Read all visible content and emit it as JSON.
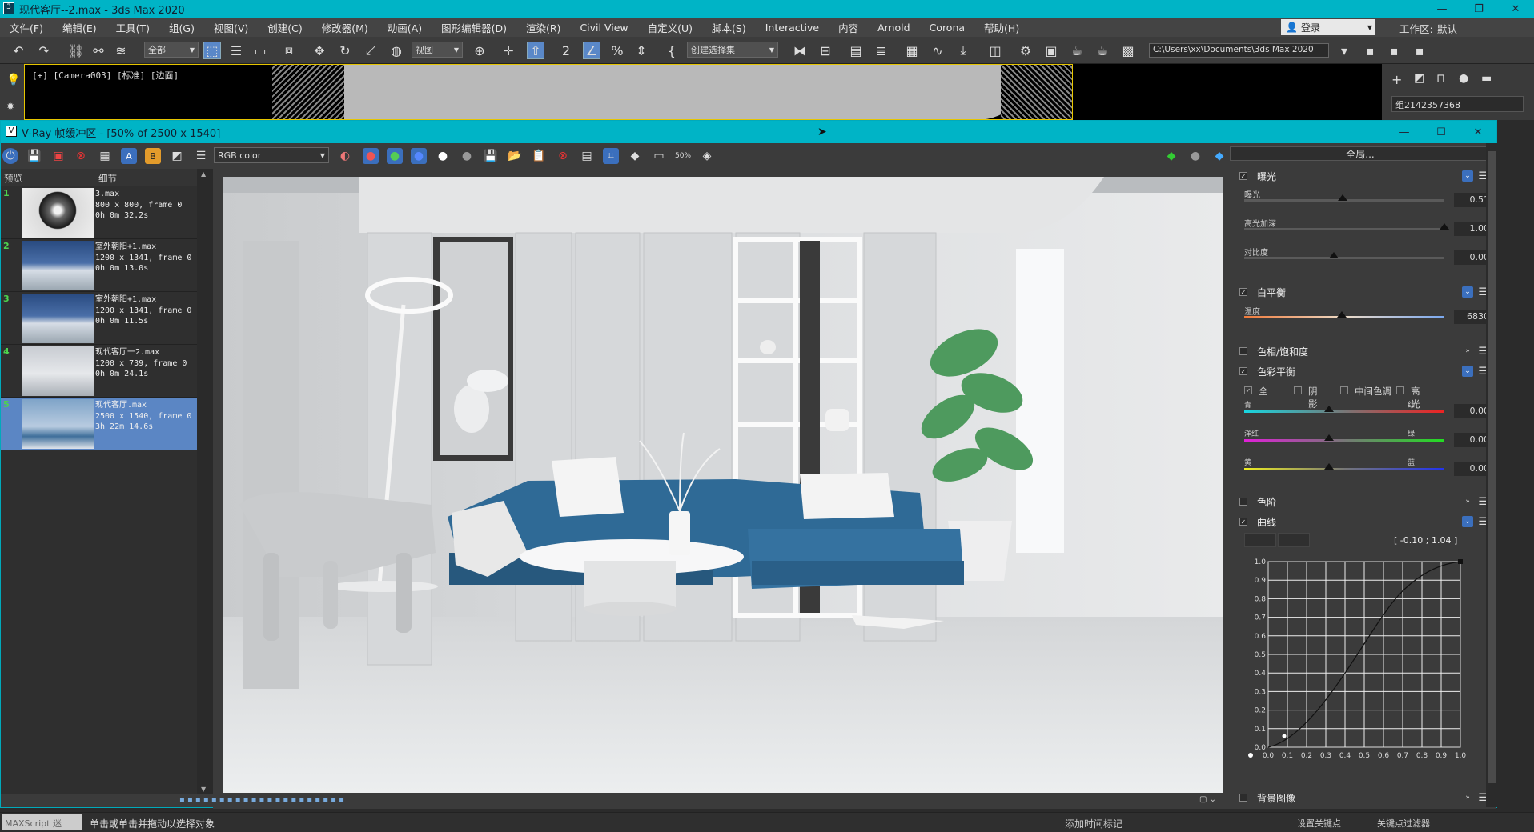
{
  "app": {
    "title": "现代客厅--2.max - 3ds Max 2020",
    "menu": [
      "文件(F)",
      "编辑(E)",
      "工具(T)",
      "组(G)",
      "视图(V)",
      "创建(C)",
      "修改器(M)",
      "动画(A)",
      "图形编辑器(D)",
      "渲染(R)",
      "Civil View",
      "自定义(U)",
      "脚本(S)",
      "Interactive",
      "内容",
      "Arnold",
      "Corona",
      "帮助(H)"
    ],
    "login": "登录",
    "workspace_label": "工作区:",
    "workspace_value": "默认"
  },
  "toolbar": {
    "filter": "全部",
    "refcoord": "视图",
    "selection_set": "创建选择集",
    "path": "C:\\Users\\xx\\Documents\\3ds Max 2020"
  },
  "viewport": {
    "label": "[+] [Camera003] [标准] [边面]"
  },
  "command_panel": {
    "object_name": "组2142357368"
  },
  "vfb": {
    "title": "V-Ray 帧缓冲区 - [50% of 2500 x 1540]",
    "channel": "RGB color",
    "history_header": {
      "preview": "预览",
      "details": "细节"
    },
    "history": [
      {
        "num": "1",
        "name": "3.max",
        "size": "800 x 800, frame 0",
        "time": "0h 0m 32.2s"
      },
      {
        "num": "2",
        "name": "室外朝阳+1.max",
        "size": "1200 x 1341, frame 0",
        "time": "0h 0m 13.0s"
      },
      {
        "num": "3",
        "name": "室外朝阳+1.max",
        "size": "1200 x 1341, frame 0",
        "time": "0h 0m 11.5s"
      },
      {
        "num": "4",
        "name": "现代客厅一2.max",
        "size": "1200 x 739, frame 0",
        "time": "0h 0m 24.1s"
      },
      {
        "num": "5",
        "name": "现代客厅.max",
        "size": "2500 x 1540, frame 0",
        "time": "3h 22m 14.6s"
      }
    ],
    "panel": {
      "global_btn": "全局...",
      "exposure": {
        "title": "曝光",
        "exposure_label": "曝光",
        "exposure_val": "0.51",
        "highlight_label": "高光加深",
        "highlight_val": "1.00",
        "contrast_label": "对比度",
        "contrast_val": "0.00"
      },
      "whitebalance": {
        "title": "白平衡",
        "temp_label": "温度",
        "temp_val": "6830"
      },
      "hue_sat": {
        "title": "色相/饱和度"
      },
      "color_balance": {
        "title": "色彩平衡",
        "opt_all": "全",
        "opt_shadow": "阴影",
        "opt_mid": "中间色调",
        "opt_high": "高光",
        "cyan": "青",
        "red": "红",
        "cr_val": "0.00",
        "magenta": "洋红",
        "green": "绿",
        "mg_val": "0.00",
        "yellow": "黄",
        "blue": "蓝",
        "yb_val": "0.00"
      },
      "levels": {
        "title": "色阶"
      },
      "curves": {
        "title": "曲线",
        "coord": "[ -0.10 ; 1.04 ]",
        "yticks": [
          "1.0",
          "0.9",
          "0.8",
          "0.7",
          "0.6",
          "0.5",
          "0.4",
          "0.3",
          "0.2",
          "0.1",
          "0.0"
        ],
        "xticks": [
          "0.0",
          "0.1",
          "0.2",
          "0.3",
          "0.4",
          "0.5",
          "0.6",
          "0.7",
          "0.8",
          "0.9",
          "1.0"
        ]
      },
      "background": {
        "title": "背景图像"
      }
    }
  },
  "status": {
    "maxscript": "MAXScript 迷",
    "message": "单击或单击并拖动以选择对象",
    "add_time_tag": "添加时间标记",
    "set_key": "设置关键点",
    "key_filter": "关键点过滤器"
  }
}
